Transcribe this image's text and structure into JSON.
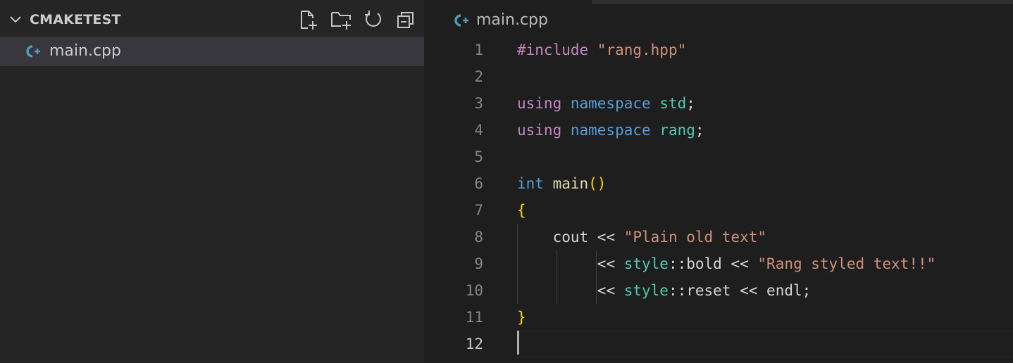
{
  "explorer": {
    "section_title": "CMAKETEST",
    "toolbar": [
      {
        "name": "new-file-icon"
      },
      {
        "name": "new-folder-icon"
      },
      {
        "name": "refresh-icon"
      },
      {
        "name": "collapse-all-icon"
      }
    ],
    "files": [
      {
        "label": "main.cpp",
        "icon": "cpp-file-icon",
        "selected": true
      }
    ]
  },
  "editor": {
    "breadcrumb": {
      "label": "main.cpp",
      "icon": "cpp-file-icon"
    },
    "current_line": 12,
    "lines": [
      {
        "n": "1",
        "tokens": [
          {
            "t": "#include ",
            "c": "directive"
          },
          {
            "t": "\"rang.hpp\"",
            "c": "string"
          }
        ]
      },
      {
        "n": "2",
        "tokens": []
      },
      {
        "n": "3",
        "tokens": [
          {
            "t": "using ",
            "c": "control"
          },
          {
            "t": "namespace ",
            "c": "keyword"
          },
          {
            "t": "std",
            "c": "ns"
          },
          {
            "t": ";",
            "c": "punct"
          }
        ]
      },
      {
        "n": "4",
        "tokens": [
          {
            "t": "using ",
            "c": "control"
          },
          {
            "t": "namespace ",
            "c": "keyword"
          },
          {
            "t": "rang",
            "c": "ns"
          },
          {
            "t": ";",
            "c": "punct"
          }
        ]
      },
      {
        "n": "5",
        "tokens": []
      },
      {
        "n": "6",
        "tokens": [
          {
            "t": "int ",
            "c": "keyword"
          },
          {
            "t": "main",
            "c": "func"
          },
          {
            "t": "()",
            "c": "paren"
          }
        ]
      },
      {
        "n": "7",
        "tokens": [
          {
            "t": "{",
            "c": "paren"
          }
        ]
      },
      {
        "n": "8",
        "tokens": [
          {
            "t": "    ",
            "c": "var"
          },
          {
            "t": "cout",
            "c": "var"
          },
          {
            "t": " << ",
            "c": "op"
          },
          {
            "t": "\"Plain old text\"",
            "c": "string"
          }
        ]
      },
      {
        "n": "9",
        "tokens": [
          {
            "t": "         ",
            "c": "var"
          },
          {
            "t": "<< ",
            "c": "op"
          },
          {
            "t": "style",
            "c": "ns"
          },
          {
            "t": "::",
            "c": "op"
          },
          {
            "t": "bold",
            "c": "var"
          },
          {
            "t": " << ",
            "c": "op"
          },
          {
            "t": "\"Rang styled text!!\"",
            "c": "string"
          }
        ]
      },
      {
        "n": "10",
        "tokens": [
          {
            "t": "         ",
            "c": "var"
          },
          {
            "t": "<< ",
            "c": "op"
          },
          {
            "t": "style",
            "c": "ns"
          },
          {
            "t": "::",
            "c": "op"
          },
          {
            "t": "reset",
            "c": "var"
          },
          {
            "t": " << ",
            "c": "op"
          },
          {
            "t": "endl",
            "c": "var"
          },
          {
            "t": ";",
            "c": "punct"
          }
        ]
      },
      {
        "n": "11",
        "tokens": [
          {
            "t": "}",
            "c": "paren"
          }
        ]
      },
      {
        "n": "12",
        "tokens": []
      }
    ]
  },
  "colors": {
    "editor_bg": "#1e1e1e",
    "sidebar_bg": "#252526",
    "selection_bg": "#37373d",
    "cpp_icon": "#519aba",
    "string": "#ce9178",
    "keyword": "#569cd6",
    "control": "#c586c0",
    "namespace": "#4ec9b0",
    "function": "#dcdcaa",
    "bracket": "#ffd700"
  }
}
